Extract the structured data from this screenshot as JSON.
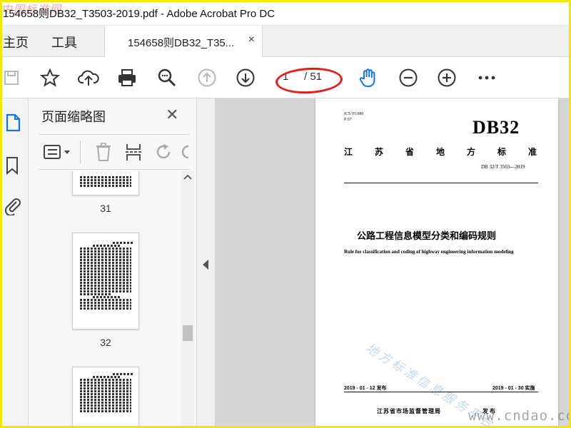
{
  "window": {
    "title": "154658则DB32_T3503-2019.pdf - Adobe Acrobat Pro DC",
    "watermark_top": "中国标准网"
  },
  "tabs": {
    "home": "主页",
    "tools": "工具",
    "document": "154658则DB32_T35...",
    "close_symbol": "×"
  },
  "toolbar": {
    "page_current": "1",
    "page_total": "/ 51",
    "icons": [
      "save-icon",
      "star-icon",
      "upload-icon",
      "print-icon",
      "zoom-search-icon",
      "arrow-up-icon",
      "arrow-down-icon",
      "hand-icon",
      "zoom-out-icon",
      "zoom-in-icon",
      "more-icon"
    ],
    "accent_color": "#1473e6"
  },
  "panel": {
    "title": "页面缩略图",
    "close_symbol": "✕",
    "thumbnails": [
      {
        "label": "31"
      },
      {
        "label": "32"
      },
      {
        "label": ""
      }
    ]
  },
  "document": {
    "ics_line1": "ICS  93.080",
    "ics_line2": "P  07",
    "db_code": "DB32",
    "category": "江苏省地方标准",
    "std_code": "DB 32/T 3503—2019",
    "title_cn": "公路工程信息模型分类和编码规则",
    "title_en": "Rule for classification and coding of highway engineering information modeling",
    "watermark": "地方标准信息服务平台",
    "issue_date": "2019 - 01 - 12 发布",
    "effective_date": "2019 - 01 - 30 实施",
    "publisher": "江苏省市场监督管理局",
    "publish_word": "发布"
  },
  "watermark_bottom": "www.cndao.com"
}
